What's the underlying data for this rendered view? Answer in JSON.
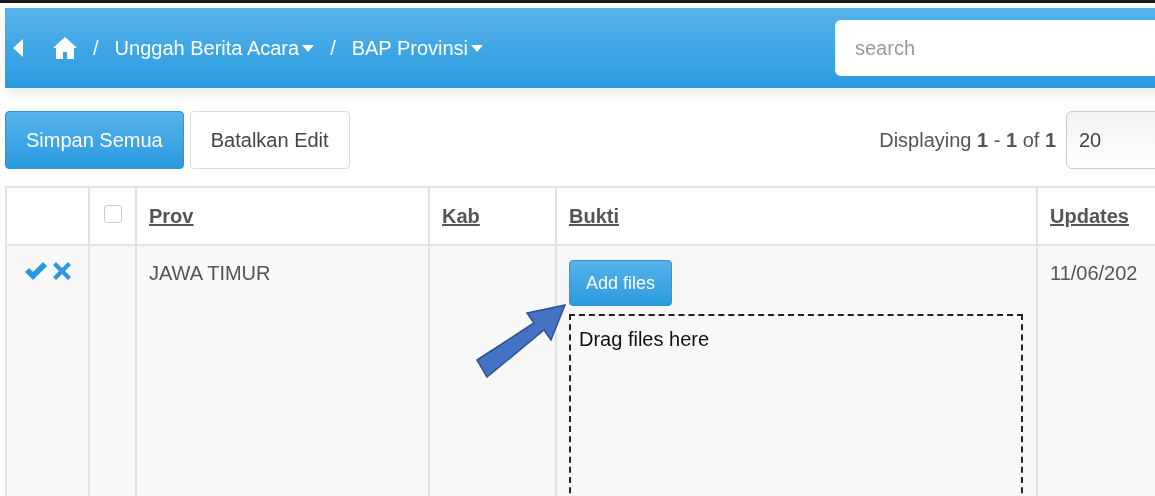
{
  "breadcrumb": {
    "items": [
      {
        "separator": "/",
        "label": "Unggah Berita Acara",
        "dropdown": true
      },
      {
        "separator": "/",
        "label": "BAP Provinsi",
        "dropdown": true
      }
    ]
  },
  "search": {
    "placeholder": "search"
  },
  "toolbar": {
    "buttons": [
      {
        "label": "Simpan Semua",
        "kind": "primary"
      },
      {
        "label": "Batalkan Edit",
        "kind": "default"
      }
    ],
    "pagination": {
      "text": "Displaying **1** - **1** of **1**",
      "page_size": "20"
    }
  },
  "table": {
    "select_all": {
      "checked": false
    },
    "columns": [
      "Prov",
      "Kab",
      "Bukti",
      "Updates"
    ],
    "rows": [
      {
        "editing": true,
        "prov": "JAWA TIMUR",
        "bukti": {
          "button": "Add files",
          "drop_hint": "Drag files here"
        },
        "updates": "11/06/202"
      }
    ]
  }
}
